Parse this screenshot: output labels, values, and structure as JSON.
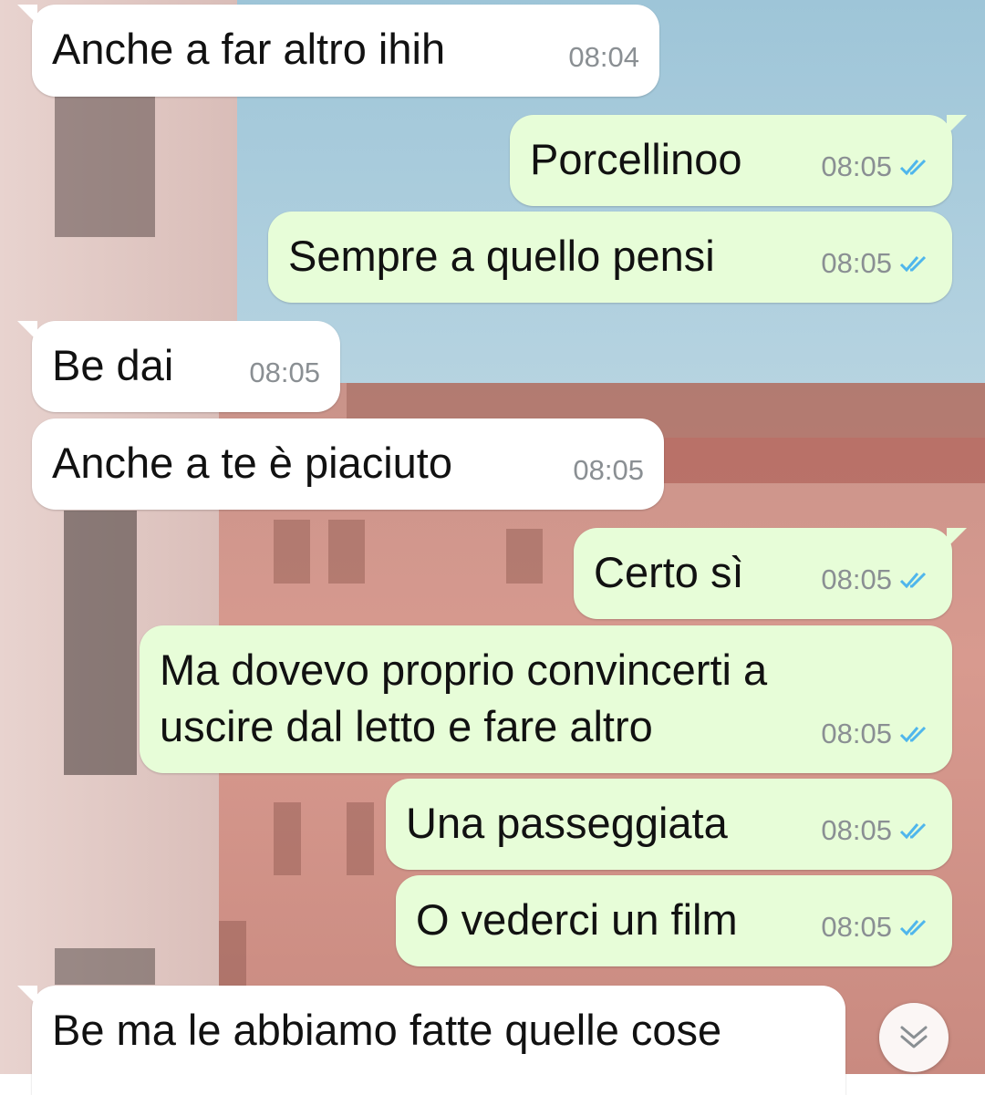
{
  "messages": [
    {
      "dir": "in",
      "text": "Anche a far altro ihih",
      "time": "08:04"
    },
    {
      "dir": "out",
      "text": "Porcellinoo",
      "time": "08:05",
      "status": "read"
    },
    {
      "dir": "out",
      "text": "Sempre a quello pensi",
      "time": "08:05",
      "status": "read"
    },
    {
      "dir": "in",
      "text": "Be dai",
      "time": "08:05"
    },
    {
      "dir": "in",
      "text": "Anche a te è piaciuto",
      "time": "08:05"
    },
    {
      "dir": "out",
      "text": "Certo sì",
      "time": "08:05",
      "status": "read"
    },
    {
      "dir": "out",
      "text": "Ma dovevo proprio convincerti a\nuscire dal letto e fare altro",
      "time": "08:05",
      "status": "read"
    },
    {
      "dir": "out",
      "text": "Una passeggiata",
      "time": "08:05",
      "status": "read"
    },
    {
      "dir": "out",
      "text": "O vederci un film",
      "time": "08:05",
      "status": "read"
    },
    {
      "dir": "in",
      "text": "Be ma le abbiamo fatte quelle cose",
      "time": ""
    }
  ],
  "colors": {
    "incoming_bubble": "#ffffff",
    "outgoing_bubble": "#e7fdd8",
    "read_ticks": "#4fb6ec",
    "timestamp": "#8a8f93"
  },
  "scroll_button": {
    "icon": "double-chevron-down-icon"
  }
}
